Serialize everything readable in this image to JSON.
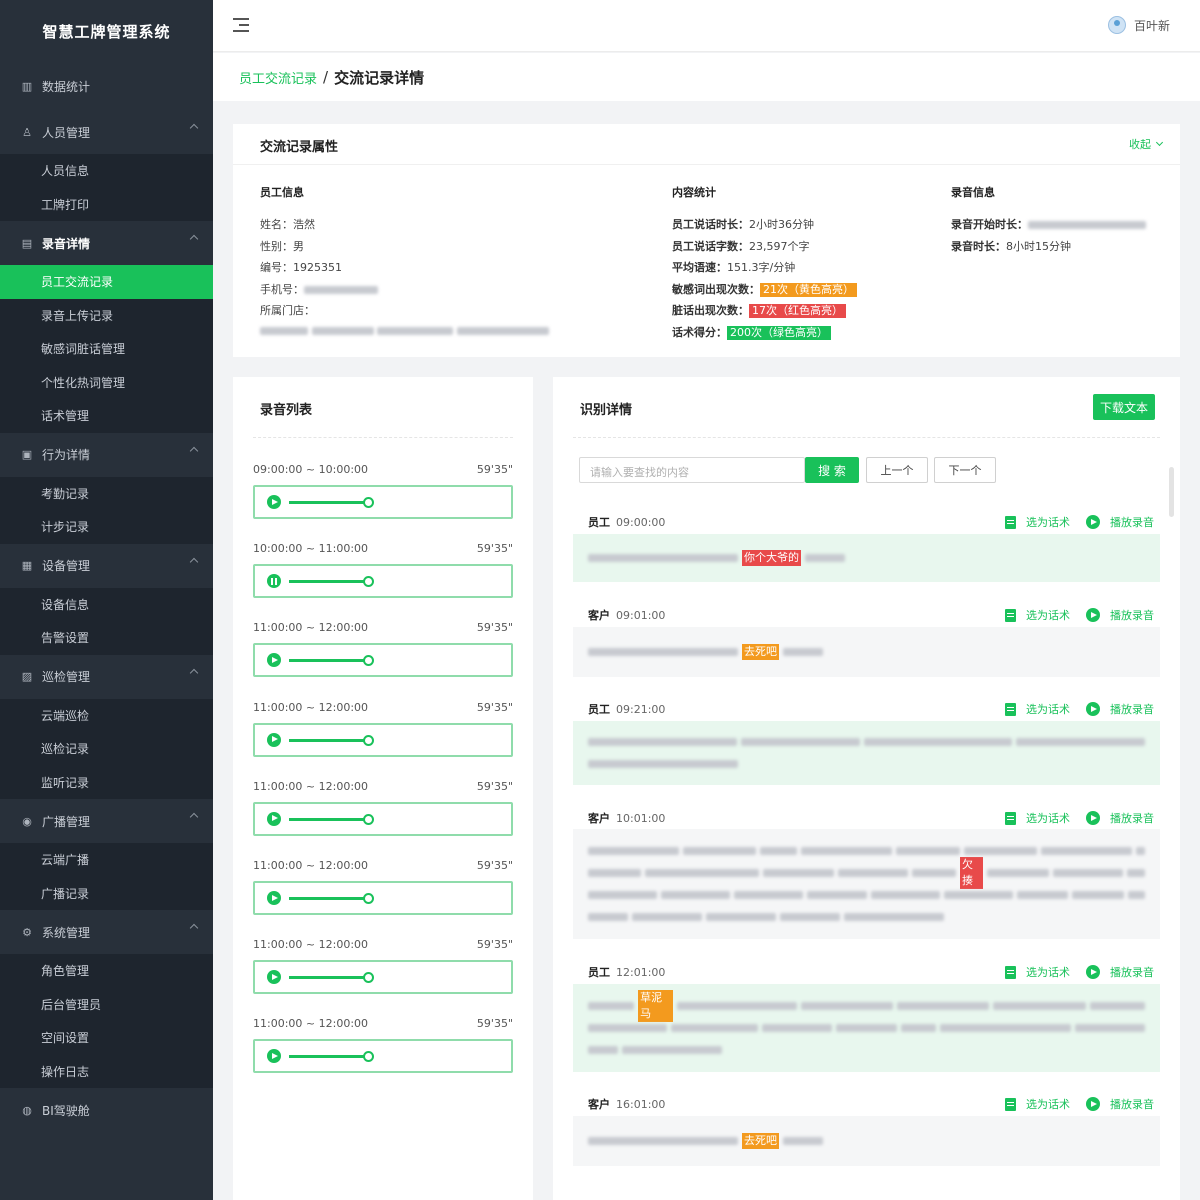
{
  "app": {
    "title": "智慧工牌管理系统"
  },
  "sidebar": {
    "items": [
      {
        "icon": "bar-chart-icon",
        "label": "数据统计"
      },
      {
        "icon": "people-icon",
        "label": "人员管理",
        "children": [
          "人员信息",
          "工牌打印"
        ]
      },
      {
        "icon": "record-icon",
        "label": "录音详情",
        "children": [
          "员工交流记录",
          "录音上传记录",
          "敏感词脏话管理",
          "个性化热词管理",
          "话术管理"
        ]
      },
      {
        "icon": "behavior-icon",
        "label": "行为详情",
        "children": [
          "考勤记录",
          "计步记录"
        ]
      },
      {
        "icon": "device-icon",
        "label": "设备管理",
        "children": [
          "设备信息",
          "告警设置"
        ]
      },
      {
        "icon": "patrol-icon",
        "label": "巡检管理",
        "children": [
          "云端巡检",
          "巡检记录",
          "监听记录"
        ]
      },
      {
        "icon": "broadcast-icon",
        "label": "广播管理",
        "children": [
          "云端广播",
          "广播记录"
        ]
      },
      {
        "icon": "settings-icon",
        "label": "系统管理",
        "children": [
          "角色管理",
          "后台管理员",
          "空间设置",
          "操作日志"
        ]
      },
      {
        "icon": "bi-icon",
        "label": "BI驾驶舱"
      }
    ],
    "active_item": "员工交流记录"
  },
  "header": {
    "user_name": "百叶新"
  },
  "breadcrumb": {
    "parent": "员工交流记录",
    "separator": "/",
    "current": "交流记录详情"
  },
  "attributes": {
    "title": "交流记录属性",
    "collapse_label": "收起",
    "employee": {
      "heading": "员工信息",
      "name_label": "姓名：",
      "name": "浩然",
      "gender_label": "性别：",
      "gender": "男",
      "id_label": "编号：",
      "id": "1925351",
      "phone_label": "手机号：",
      "store_label": "所属门店："
    },
    "content": {
      "heading": "内容统计",
      "speak_time_label": "员工说话时长：",
      "speak_time": "2小时36分钟",
      "word_count_label": "员工说话字数：",
      "word_count": "23,597个字",
      "speed_label": "平均语速：",
      "speed": "151.3字/分钟",
      "sensitive_label": "敏感词出现次数：",
      "sensitive": "21次（黄色高亮）",
      "dirty_label": "脏话出现次数：",
      "dirty": "17次（红色高亮）",
      "script_label": "话术得分：",
      "script": "200次（绿色高亮）"
    },
    "recording": {
      "heading": "录音信息",
      "start_label": "录音开始时长：",
      "duration_label": "录音时长：",
      "duration": "8小时15分钟"
    }
  },
  "recordings": {
    "title": "录音列表",
    "items": [
      {
        "time": "09:00:00 ~ 10:00:00",
        "length": "59'35\"",
        "state": "play",
        "progress": 0.6
      },
      {
        "time": "10:00:00 ~ 11:00:00",
        "length": "59'35\"",
        "state": "pause",
        "progress": 0.6
      },
      {
        "time": "11:00:00 ~ 12:00:00",
        "length": "59'35\"",
        "state": "play",
        "progress": 0.6
      },
      {
        "time": "11:00:00 ~ 12:00:00",
        "length": "59'35\"",
        "state": "play",
        "progress": 0.6
      },
      {
        "time": "11:00:00 ~ 12:00:00",
        "length": "59'35\"",
        "state": "play",
        "progress": 0.6
      },
      {
        "time": "11:00:00 ~ 12:00:00",
        "length": "59'35\"",
        "state": "play",
        "progress": 0.6
      },
      {
        "time": "11:00:00 ~ 12:00:00",
        "length": "59'35\"",
        "state": "play",
        "progress": 0.6
      },
      {
        "time": "11:00:00 ~ 12:00:00",
        "length": "59'35\"",
        "state": "play",
        "progress": 0.6
      }
    ]
  },
  "recognition": {
    "title": "识别详情",
    "download_label": "下载文本",
    "search_placeholder": "请输入要查找的内容",
    "search_label": "搜 索",
    "prev_label": "上一个",
    "next_label": "下一个",
    "select_label": "选为话术",
    "play_label": "播放录音",
    "colors": {
      "green": "#19c15a",
      "red": "#e84a4a",
      "orange": "#f39a1e"
    },
    "dialogs": [
      {
        "speaker": "员工",
        "time": "09:00:00",
        "highlight": "你个大爷的",
        "hl_color": "red"
      },
      {
        "speaker": "客户",
        "time": "09:01:00",
        "highlight": "去死吧",
        "hl_color": "orange"
      },
      {
        "speaker": "员工",
        "time": "09:21:00"
      },
      {
        "speaker": "客户",
        "time": "10:01:00",
        "highlight": "欠揍",
        "hl_color": "red"
      },
      {
        "speaker": "员工",
        "time": "12:01:00",
        "highlight": "草泥马",
        "hl_color": "orange"
      },
      {
        "speaker": "客户",
        "time": "16:01:00",
        "highlight": "去死吧",
        "hl_color": "orange"
      }
    ]
  }
}
